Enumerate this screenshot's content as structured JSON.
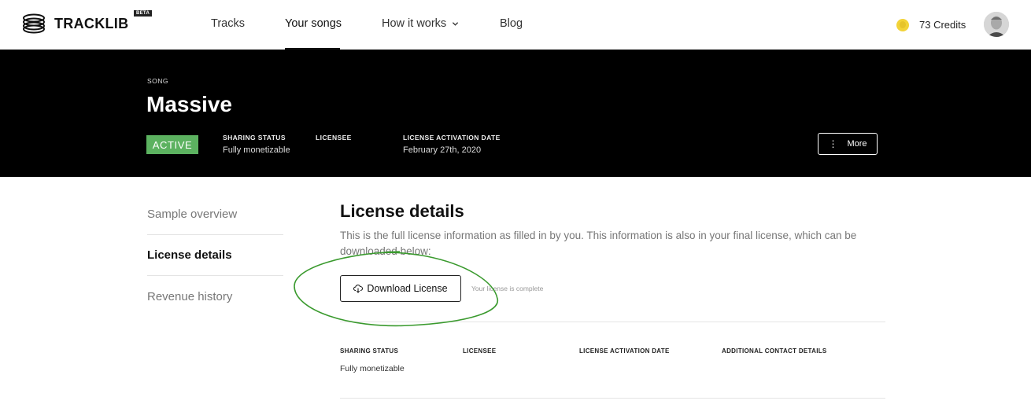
{
  "brand": {
    "name": "TRACKLIB",
    "badge": "BETA"
  },
  "nav": {
    "items": [
      "Tracks",
      "Your songs",
      "How it works",
      "Blog"
    ],
    "active": "Your songs"
  },
  "account": {
    "credits": "73 Credits"
  },
  "song": {
    "eyebrow": "SONG",
    "title": "Massive",
    "status": "ACTIVE",
    "meta": {
      "sharing_label": "SHARING STATUS",
      "sharing_value": "Fully monetizable",
      "licensee_label": "LICENSEE",
      "date_label": "LICENSE ACTIVATION DATE",
      "date_value": "February 27th, 2020"
    },
    "more_label": "More"
  },
  "sidenav": {
    "items": [
      "Sample overview",
      "License details",
      "Revenue history"
    ],
    "active": "License details"
  },
  "license": {
    "title": "License details",
    "description": "This is the full license information as filled in by you. This information is also in your final license, which can be downloaded below:",
    "download_label": "Download License",
    "complete_note": "Your license is complete",
    "fields": {
      "sharing_label": "SHARING STATUS",
      "sharing_value": "Fully monetizable",
      "licensee_label": "LICENSEE",
      "date_label": "LICENSE ACTIVATION DATE",
      "contact_label": "ADDITIONAL CONTACT DETAILS"
    }
  },
  "colors": {
    "active_badge": "#5cb260",
    "annotation": "#3a9a2e",
    "header_bg": "#000000",
    "coin": "#f2d338"
  }
}
